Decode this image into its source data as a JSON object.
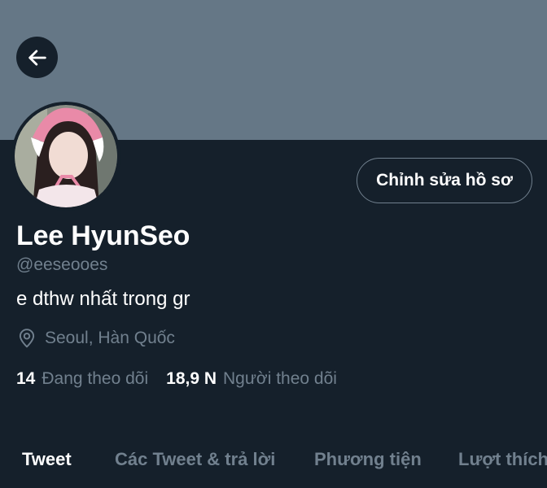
{
  "header": {
    "back_icon": "arrow-left-icon",
    "banner_color": "#657786"
  },
  "profile": {
    "display_name": "Lee HyunSeo",
    "handle": "@eeseooes",
    "bio": "e dthw nhất trong gr",
    "location": "Seoul, Hàn Quốc",
    "location_icon": "map-pin-icon",
    "edit_button_label": "Chỉnh sửa hồ sơ",
    "following_count": "14",
    "following_label": "Đang theo dõi",
    "followers_count": "18,9 N",
    "followers_label": "Người theo dõi"
  },
  "tabs": [
    {
      "label": "Tweet",
      "active": true
    },
    {
      "label": "Các Tweet & trả lời",
      "active": false
    },
    {
      "label": "Phương tiện",
      "active": false
    },
    {
      "label": "Lượt thích",
      "active": false
    }
  ],
  "colors": {
    "background": "#15202b",
    "secondary_text": "#71808e",
    "primary_text": "#ffffff"
  }
}
